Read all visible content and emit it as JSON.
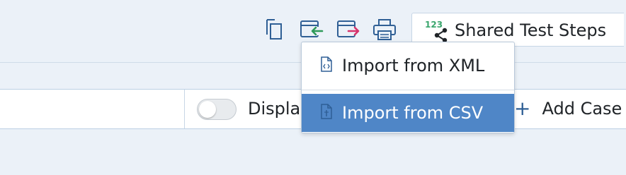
{
  "toolbar": {
    "icons": [
      "copy-icon",
      "import-icon",
      "export-icon",
      "print-icon"
    ],
    "shared_steps": {
      "badge": "123",
      "label": "Shared Test Steps"
    }
  },
  "bar": {
    "toggle_on": false,
    "display_label": "Displa",
    "add_case_label": "Add Case"
  },
  "import_menu": {
    "items": [
      {
        "label": "Import from XML",
        "icon": "xml-file-icon",
        "highlighted": false
      },
      {
        "label": "Import from CSV",
        "icon": "csv-file-icon",
        "highlighted": true
      }
    ]
  },
  "colors": {
    "background": "#ebf1f8",
    "highlight": "#4f86c7",
    "import_arrow": "#2e9a5a",
    "export_arrow": "#d6336c",
    "icon_blue": "#2f5f95"
  }
}
